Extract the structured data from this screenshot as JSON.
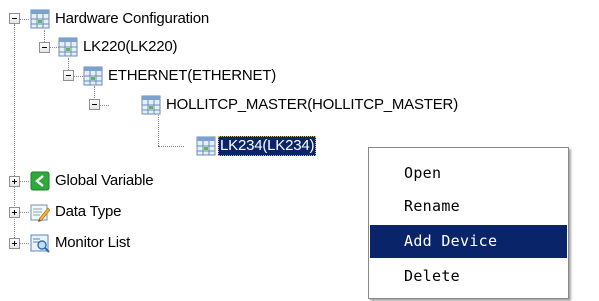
{
  "tree": {
    "nodes": [
      {
        "label": "Hardware Configuration",
        "expanded": true,
        "icon": "hardware-grid-icon"
      },
      {
        "label": "LK220(LK220)",
        "expanded": true,
        "icon": "hardware-grid-icon"
      },
      {
        "label": "ETHERNET(ETHERNET)",
        "expanded": true,
        "icon": "hardware-grid-icon"
      },
      {
        "label": "HOLLITCP_MASTER(HOLLITCP_MASTER)",
        "expanded": true,
        "icon": "hardware-grid-icon"
      },
      {
        "label": "LK234(LK234)",
        "selected": true,
        "icon": "hardware-grid-icon"
      },
      {
        "label": "Global Variable",
        "expanded": false,
        "icon": "global-variable-icon"
      },
      {
        "label": "Data Type",
        "expanded": false,
        "icon": "data-type-icon"
      },
      {
        "label": "Monitor List",
        "expanded": false,
        "icon": "monitor-list-icon"
      }
    ]
  },
  "context_menu": {
    "items": [
      {
        "label": "Open"
      },
      {
        "label": "Rename"
      },
      {
        "label": "Add Device",
        "highlighted": true
      },
      {
        "label": "Delete"
      }
    ]
  },
  "colors": {
    "selection": "#0a246a",
    "selection_text": "#ffffff",
    "connector": "#8a8a8a",
    "global_variable_green": "#2eaa3c",
    "grid_icon_green": "#5cb85c"
  }
}
